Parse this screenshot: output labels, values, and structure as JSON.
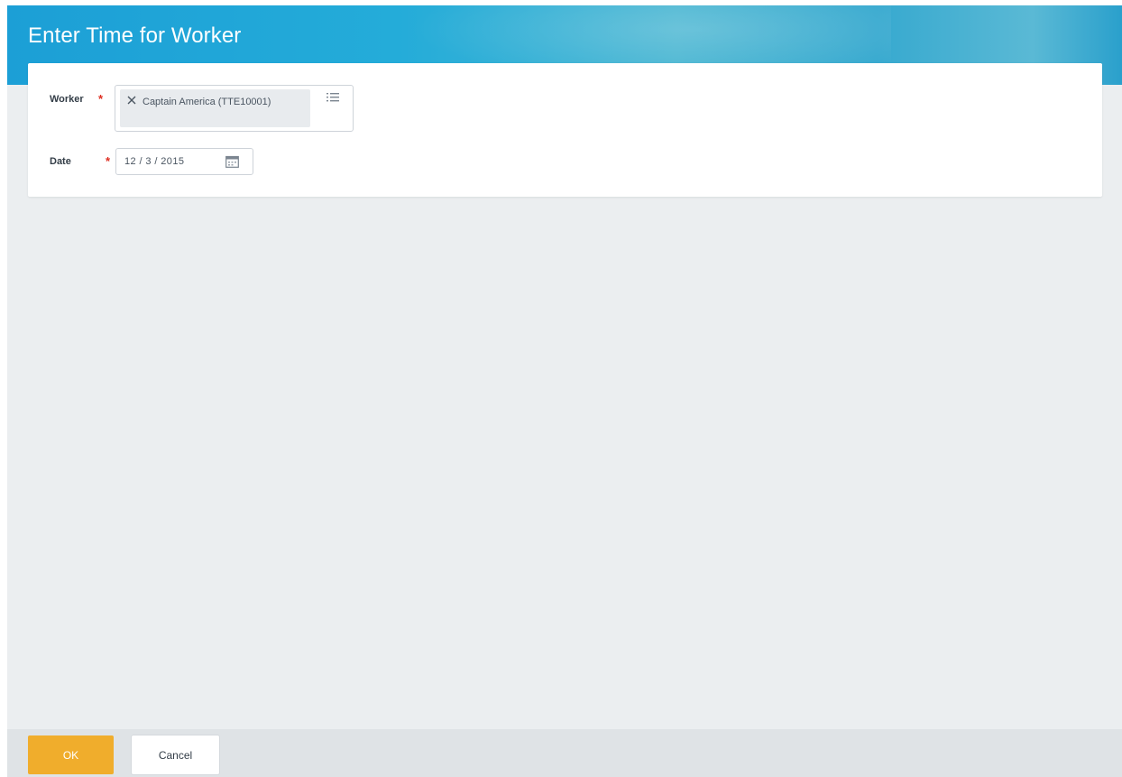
{
  "header": {
    "title": "Enter Time for Worker"
  },
  "form": {
    "worker": {
      "label": "Worker",
      "required_mark": "*",
      "selected": "Captain America (TTE10001)"
    },
    "date": {
      "label": "Date",
      "required_mark": "*",
      "value": "12 / 3 / 2015"
    }
  },
  "footer": {
    "ok_label": "OK",
    "cancel_label": "Cancel"
  },
  "colors": {
    "header_blue": "#1c9fd6",
    "required_red": "#de2e21",
    "primary_button": "#f0ad2c"
  },
  "icons": [
    "close-icon",
    "prompt-list-icon",
    "calendar-icon"
  ]
}
